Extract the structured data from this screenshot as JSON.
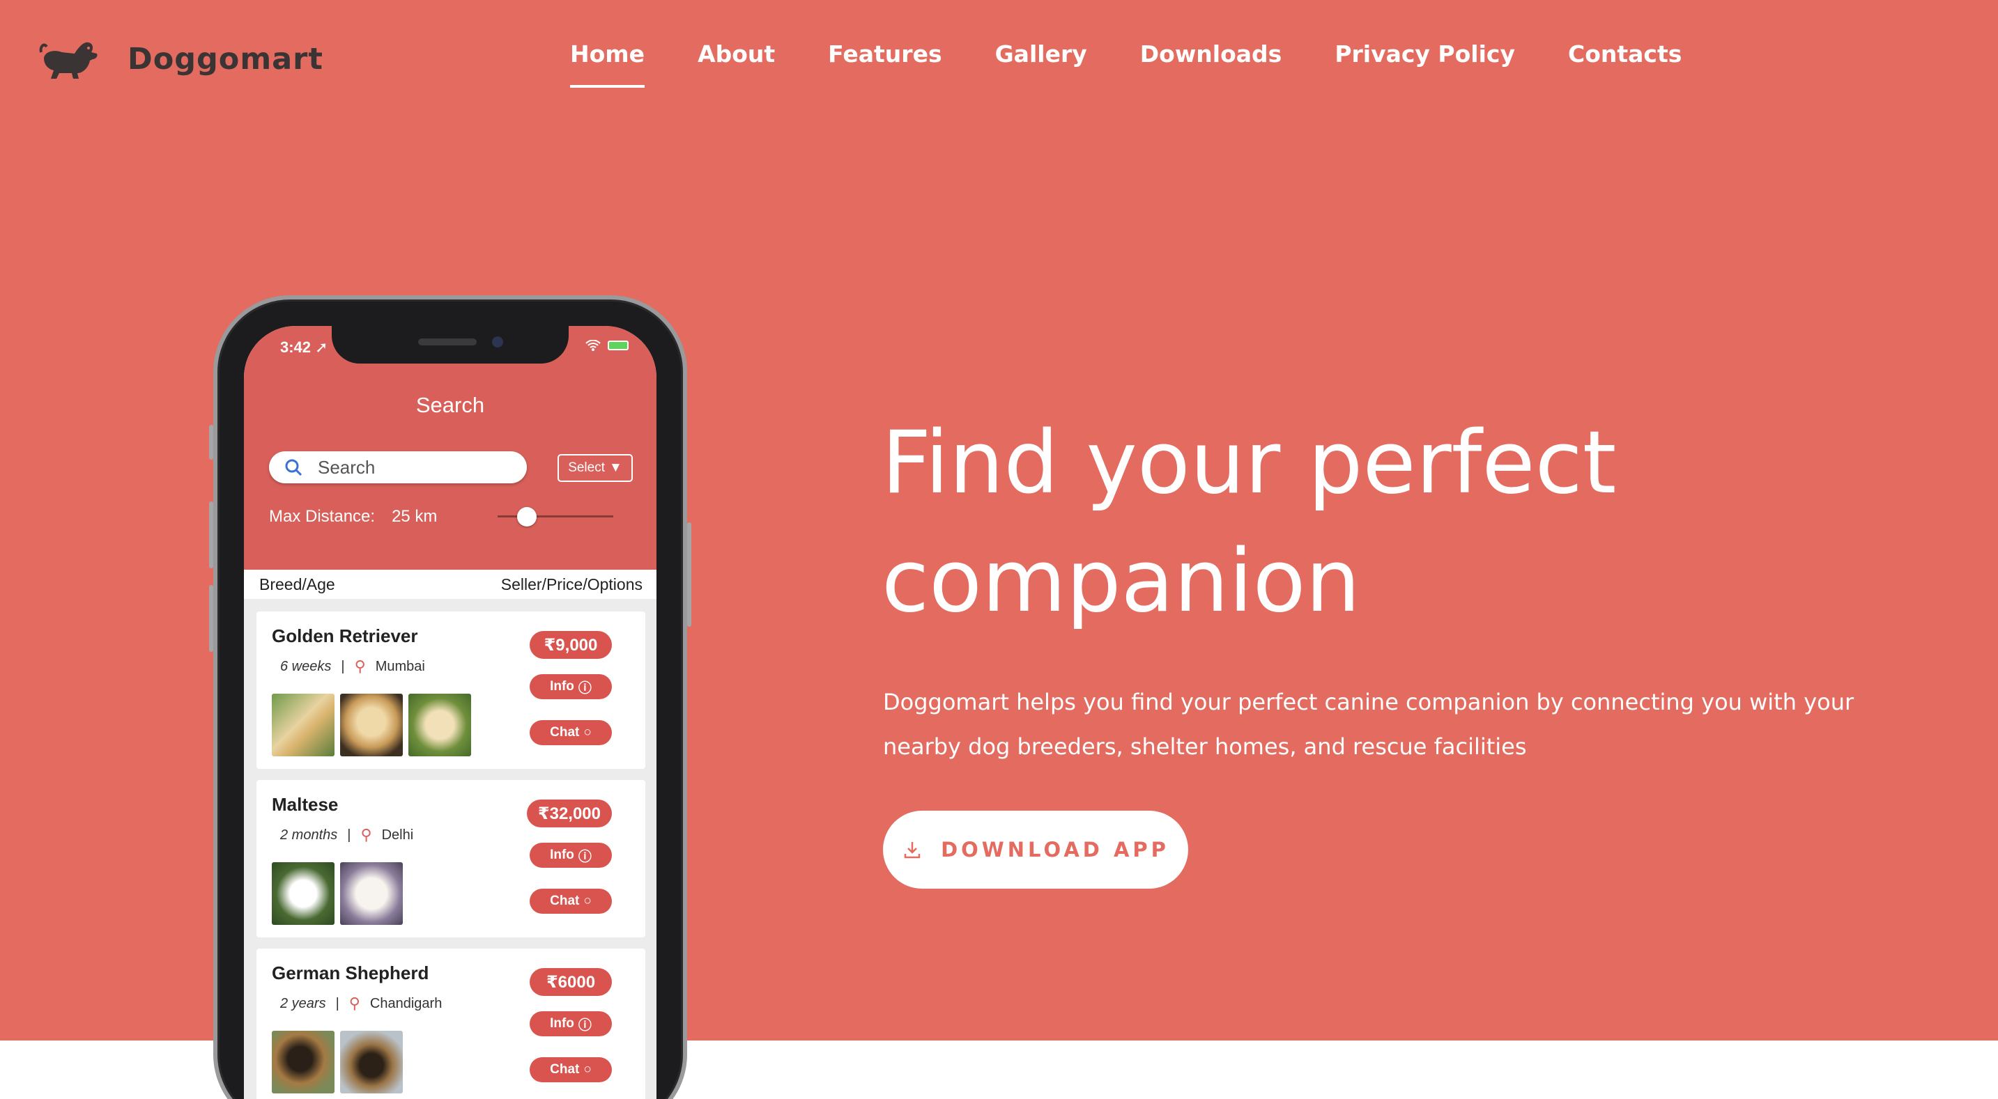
{
  "brand": {
    "name": "Doggomart",
    "logo_icon": "dog-logo-icon"
  },
  "nav": {
    "items": [
      {
        "label": "Home",
        "active": true
      },
      {
        "label": "About"
      },
      {
        "label": "Features"
      },
      {
        "label": "Gallery"
      },
      {
        "label": "Downloads"
      },
      {
        "label": "Privacy Policy"
      },
      {
        "label": "Contacts"
      }
    ]
  },
  "hero": {
    "headline_line1": "Find your perfect",
    "headline_line2": "companion",
    "lead": "Doggomart helps you find your perfect canine companion by connecting you with your nearby dog breeders, shelter homes, and rescue facilities",
    "cta_label": "DOWNLOAD APP",
    "cta_icon": "download-icon"
  },
  "colors": {
    "background": "#e46b60",
    "app_header": "#d9605a",
    "button_red": "#d9534f",
    "brand_text": "#3a3434"
  },
  "phone": {
    "time": "3:42",
    "screen_title": "Search",
    "search_placeholder": "Search",
    "select_label": "Select",
    "distance_label": "Max Distance:",
    "distance_value": "25 km",
    "distance_slider_fraction": 0.2,
    "col_left": "Breed/Age",
    "col_right": "Seller/Price/Options",
    "listings": [
      {
        "breed": "Golden Retriever",
        "age": "6 weeks",
        "location": "Mumbai",
        "price": "₹9,000",
        "info": "Info",
        "chat": "Chat",
        "photo_count": 3
      },
      {
        "breed": "Maltese",
        "age": "2 months",
        "location": "Delhi",
        "price": "₹32,000",
        "info": "Info",
        "chat": "Chat",
        "photo_count": 2
      },
      {
        "breed": "German Shepherd",
        "age": "2 years",
        "location": "Chandigarh",
        "price": "₹6000",
        "info": "Info",
        "chat": "Chat",
        "photo_count": 2
      }
    ]
  }
}
